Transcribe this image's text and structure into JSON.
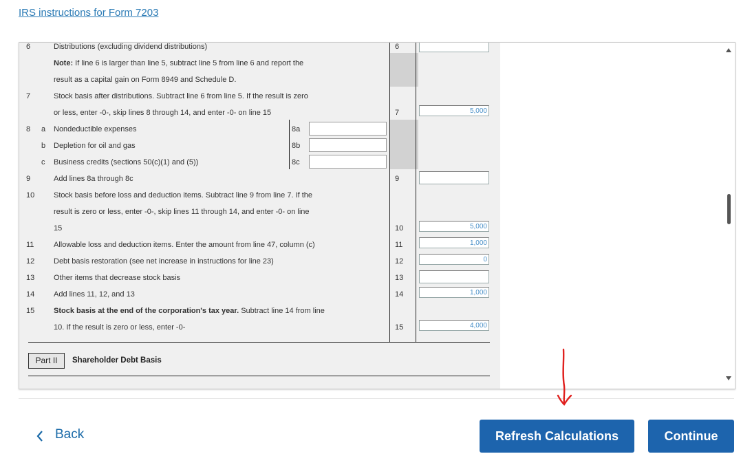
{
  "link": {
    "text": "IRS instructions for Form 7203"
  },
  "form": {
    "lines": [
      {
        "num": "6",
        "sub": "",
        "text": "Distributions (excluding dividend distributions)",
        "right_label": "6",
        "value": ""
      },
      {
        "num": "",
        "sub": "",
        "note_bold": "Note:",
        "text": " If line 6 is larger than line 5, subtract line 5 from line 6 and report the",
        "right_label": "",
        "value": ""
      },
      {
        "num": "",
        "sub": "",
        "text": "result as a capital gain on Form 8949 and Schedule D.",
        "right_label": "",
        "value": ""
      },
      {
        "num": "7",
        "sub": "",
        "text": "Stock basis after distributions. Subtract line 6 from line 5. If the result is zero",
        "right_label": "",
        "value": ""
      },
      {
        "num": "",
        "sub": "",
        "text": "or less, enter -0-, skip lines 8 through 14, and enter -0- on line 15",
        "right_label": "7",
        "value": "5,000"
      },
      {
        "num": "8",
        "sub": "a",
        "text": "Nondeductible expenses",
        "mid_label": "8a",
        "value": ""
      },
      {
        "num": "",
        "sub": "b",
        "text": "Depletion for oil and gas",
        "mid_label": "8b",
        "value": ""
      },
      {
        "num": "",
        "sub": "c",
        "text": "Business credits (sections 50(c)(1) and (5))",
        "mid_label": "8c",
        "value": ""
      },
      {
        "num": "9",
        "sub": "",
        "text": "Add lines 8a through 8c",
        "right_label": "9",
        "value": ""
      },
      {
        "num": "10",
        "sub": "",
        "text": "Stock basis before loss and deduction items. Subtract line 9 from line 7. If the",
        "right_label": "",
        "value": ""
      },
      {
        "num": "",
        "sub": "",
        "text": "result is zero or less, enter -0-, skip lines 11 through 14, and enter -0- on line",
        "right_label": "",
        "value": ""
      },
      {
        "num": "",
        "sub": "",
        "text": "15",
        "right_label": "10",
        "value": "5,000"
      },
      {
        "num": "11",
        "sub": "",
        "text": "Allowable loss and deduction items. Enter the amount from line 47, column (c)",
        "right_label": "11",
        "value": "1,000"
      },
      {
        "num": "12",
        "sub": "",
        "text": "Debt basis restoration (see net increase in instructions for line 23)",
        "right_label": "12",
        "value": "0"
      },
      {
        "num": "13",
        "sub": "",
        "text": "Other items that decrease stock basis",
        "right_label": "13",
        "value": ""
      },
      {
        "num": "14",
        "sub": "",
        "text": "Add lines 11, 12, and 13",
        "right_label": "14",
        "value": "1,000"
      },
      {
        "num": "15",
        "sub": "",
        "bold_text": "Stock basis at the end of the corporation's tax year.",
        "text": " Subtract line 14 from line",
        "right_label": "",
        "value": ""
      },
      {
        "num": "",
        "sub": "",
        "text": "10. If the result is zero or less, enter -0-",
        "right_label": "15",
        "value": "4,000"
      }
    ],
    "part": {
      "label": "Part II",
      "title": "Shareholder Debt Basis"
    }
  },
  "buttons": {
    "back": "Back",
    "refresh": "Refresh Calculations",
    "continue": "Continue"
  },
  "colors": {
    "primary": "#1d64ad",
    "link": "#2a7ab5",
    "annotation": "#e0201e"
  }
}
